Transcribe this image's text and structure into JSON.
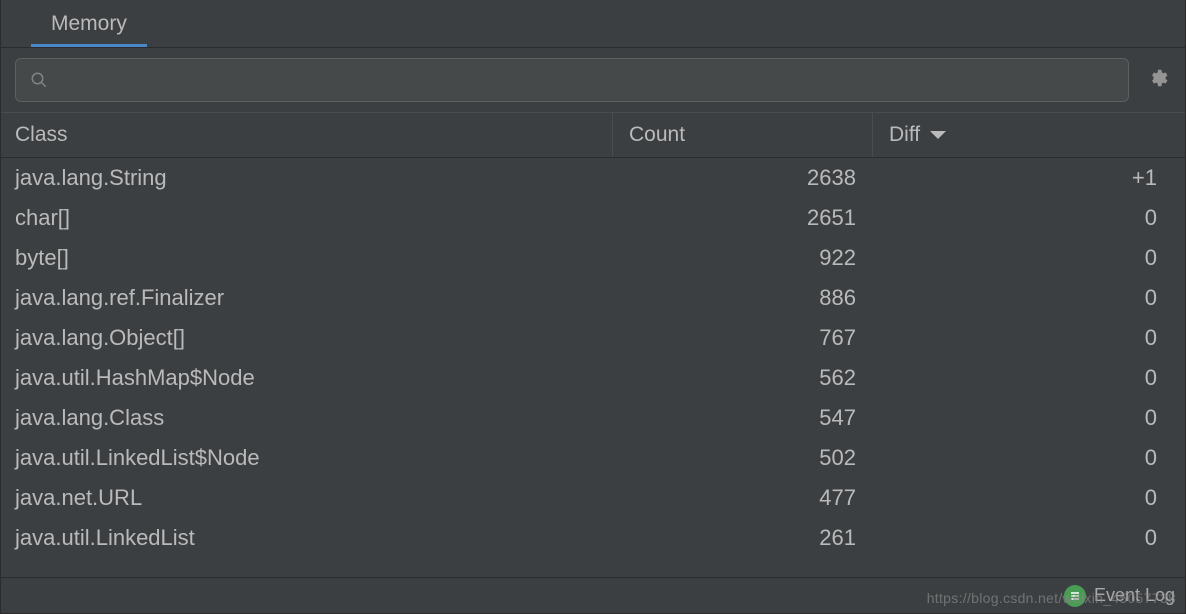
{
  "tab": {
    "label": "Memory"
  },
  "search": {
    "value": "",
    "placeholder": ""
  },
  "table": {
    "headers": {
      "class": "Class",
      "count": "Count",
      "diff": "Diff"
    },
    "rows": [
      {
        "class": "java.lang.String",
        "count": "2638",
        "diff": "+1"
      },
      {
        "class": "char[]",
        "count": "2651",
        "diff": "0"
      },
      {
        "class": "byte[]",
        "count": "922",
        "diff": "0"
      },
      {
        "class": "java.lang.ref.Finalizer",
        "count": "886",
        "diff": "0"
      },
      {
        "class": "java.lang.Object[]",
        "count": "767",
        "diff": "0"
      },
      {
        "class": "java.util.HashMap$Node",
        "count": "562",
        "diff": "0"
      },
      {
        "class": "java.lang.Class",
        "count": "547",
        "diff": "0"
      },
      {
        "class": "java.util.LinkedList$Node",
        "count": "502",
        "diff": "0"
      },
      {
        "class": "java.net.URL",
        "count": "477",
        "diff": "0"
      },
      {
        "class": "java.util.LinkedList",
        "count": "261",
        "diff": "0"
      }
    ]
  },
  "footer": {
    "event_log": "Event Log"
  },
  "watermark": "https://blog.csdn.net/weixin_45057738"
}
